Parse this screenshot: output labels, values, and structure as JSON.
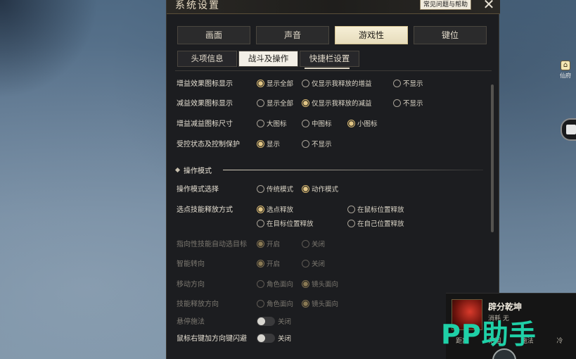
{
  "window": {
    "title": "系统设置",
    "help_label": "常见问题与帮助",
    "close_label": "✕"
  },
  "tabs": [
    {
      "label": "画面",
      "active": false
    },
    {
      "label": "声音",
      "active": false
    },
    {
      "label": "游戏性",
      "active": true
    },
    {
      "label": "键位",
      "active": false
    }
  ],
  "subtabs": [
    {
      "label": "头项信息",
      "active": false
    },
    {
      "label": "战斗及操作",
      "active": true
    },
    {
      "label": "快捷栏设置",
      "active": false
    }
  ],
  "settings": [
    {
      "label": "增益效果图标显示",
      "options": [
        {
          "label": "显示全部",
          "selected": true
        },
        {
          "label": "仅显示我释放的增益",
          "selected": false
        },
        {
          "label": "不显示",
          "selected": false
        }
      ]
    },
    {
      "label": "减益效果图标显示",
      "options": [
        {
          "label": "显示全部",
          "selected": false
        },
        {
          "label": "仅显示我释放的减益",
          "selected": true
        },
        {
          "label": "不显示",
          "selected": false
        }
      ]
    },
    {
      "label": "增益减益图标尺寸",
      "options": [
        {
          "label": "大图标",
          "selected": false
        },
        {
          "label": "中图标",
          "selected": false
        },
        {
          "label": "小图标",
          "selected": true
        }
      ]
    },
    {
      "label": "受控状态及控制保护",
      "options": [
        {
          "label": "显示",
          "selected": true
        },
        {
          "label": "不显示",
          "selected": false
        }
      ]
    }
  ],
  "section": {
    "label": "操作模式"
  },
  "operation": [
    {
      "label": "操作模式选择",
      "options": [
        {
          "label": "传统模式",
          "selected": false
        },
        {
          "label": "动作模式",
          "selected": true
        }
      ]
    },
    {
      "label": "选点技能释放方式",
      "options": [
        {
          "label": "选点释放",
          "selected": true
        },
        {
          "label": "在鼠标位置释放",
          "selected": false
        },
        {
          "label": "在目标位置释放",
          "selected": false
        },
        {
          "label": "在自己位置释放",
          "selected": false
        }
      ]
    },
    {
      "label": "指向性技能自动选目标",
      "options": [
        {
          "label": "开启",
          "selected": true
        },
        {
          "label": "关闭",
          "selected": false
        }
      ]
    },
    {
      "label": "智能转向",
      "options": [
        {
          "label": "开启",
          "selected": true
        },
        {
          "label": "关闭",
          "selected": false
        }
      ]
    },
    {
      "label": "移动方向",
      "options": [
        {
          "label": "角色面向",
          "selected": false
        },
        {
          "label": "镜头面向",
          "selected": true
        }
      ]
    },
    {
      "label": "技能释放方向",
      "options": [
        {
          "label": "角色面向",
          "selected": false
        },
        {
          "label": "镜头面向",
          "selected": true
        }
      ]
    }
  ],
  "toggles": [
    {
      "label": "悬停施法",
      "state": "关闭"
    },
    {
      "label": "鼠标右键加方向键闪避",
      "state": "关闭"
    }
  ],
  "side": {
    "xianfu_label": "仙府",
    "skill_name": "辟分乾坤",
    "skill_cost": "消耗 无",
    "skill_meta": [
      "距离",
      "范围",
      "施法",
      "冷"
    ],
    "watermark": "PP助手"
  }
}
